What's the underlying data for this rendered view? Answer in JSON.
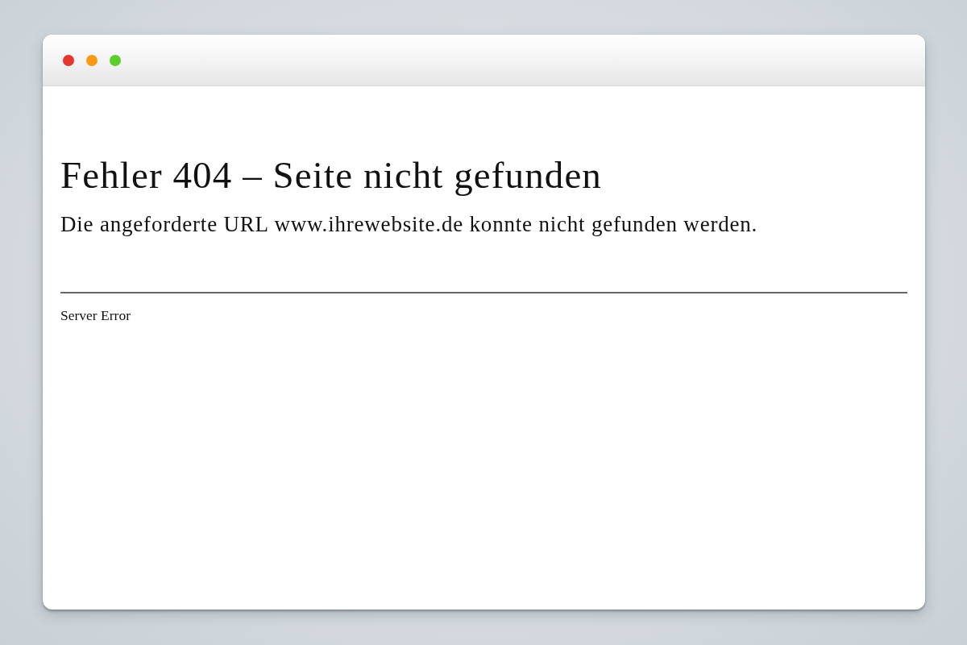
{
  "window": {
    "controls": [
      {
        "color": "#e5362c"
      },
      {
        "color": "#f89a14"
      },
      {
        "color": "#5ccf2c"
      }
    ]
  },
  "page": {
    "heading": "Fehler 404 – Seite nicht gefunden",
    "message": "Die angeforderte URL www.ihrewebsite.de konnte nicht gefunden werden.",
    "footer": "Server Error"
  }
}
